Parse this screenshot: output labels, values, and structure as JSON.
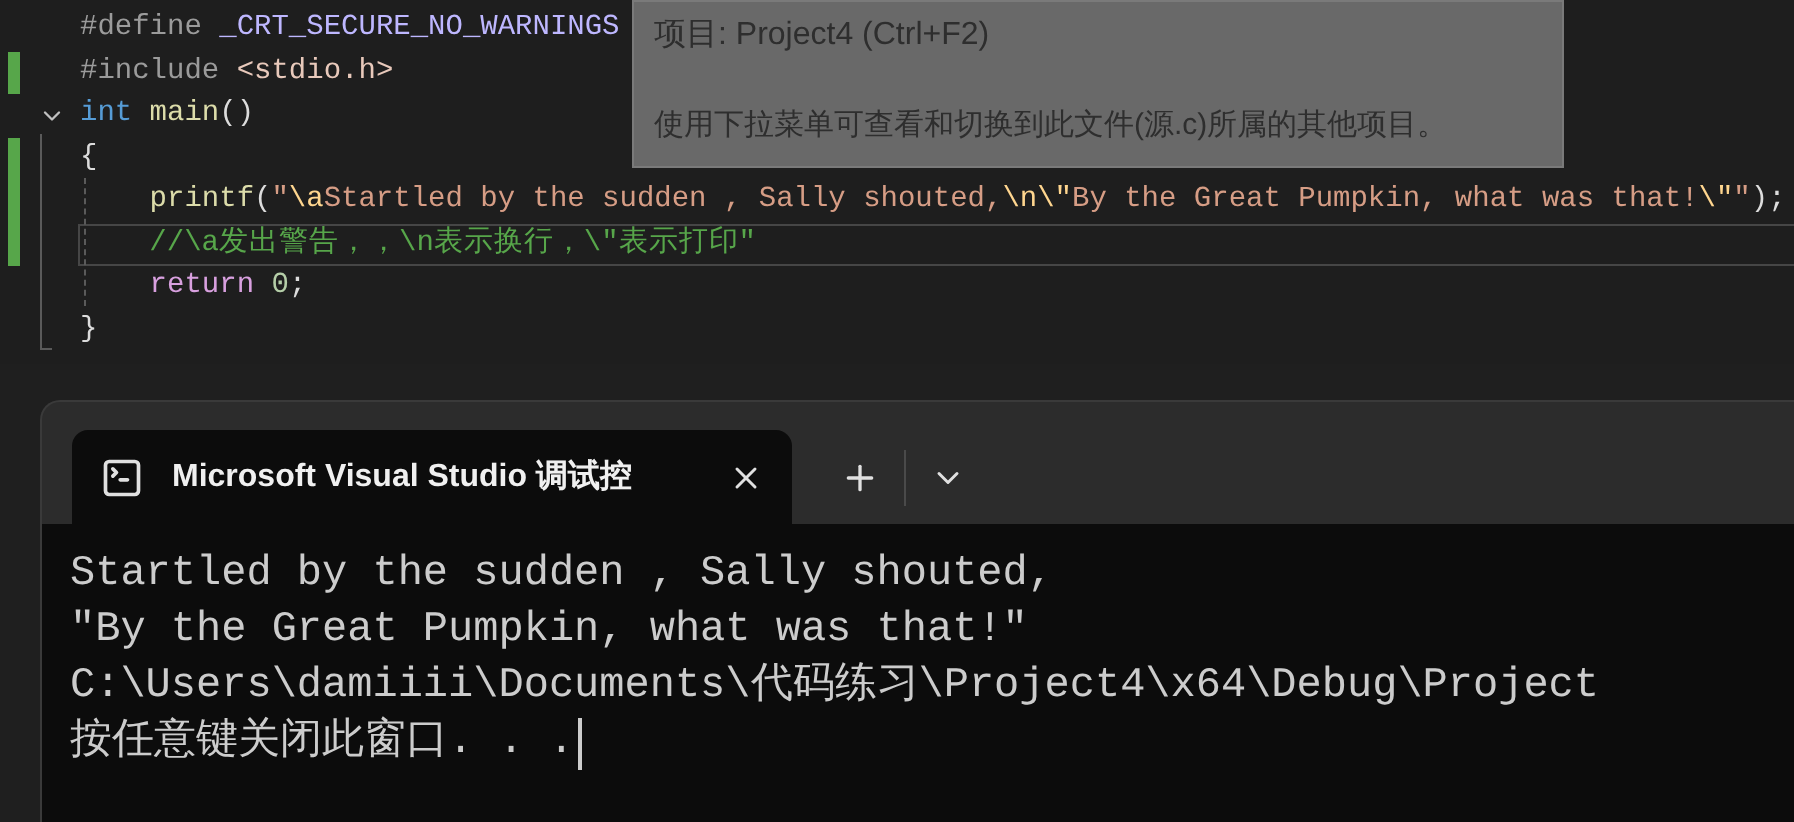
{
  "editor": {
    "lines": [
      {
        "modified": false,
        "current": false,
        "fold": false,
        "tokens": [
          {
            "text": "#define ",
            "kind": "preprocessor"
          },
          {
            "text": "_CRT_SECURE_NO_WARNINGS",
            "kind": "macro"
          }
        ]
      },
      {
        "modified": true,
        "current": false,
        "fold": false,
        "tokens": [
          {
            "text": "#include ",
            "kind": "preprocessor"
          },
          {
            "text": "<stdio.h>",
            "kind": "header"
          }
        ]
      },
      {
        "modified": false,
        "current": false,
        "fold": true,
        "tokens": [
          {
            "text": "int",
            "kind": "keyword"
          },
          {
            "text": " main",
            "kind": "function"
          },
          {
            "text": "()",
            "kind": "plain"
          }
        ]
      },
      {
        "modified": true,
        "current": false,
        "fold": false,
        "tokens": [
          {
            "text": "{",
            "kind": "plain"
          }
        ]
      },
      {
        "modified": true,
        "current": false,
        "fold": false,
        "tokens": [
          {
            "text": "    printf",
            "kind": "function"
          },
          {
            "text": "(",
            "kind": "plain"
          },
          {
            "text": "\"",
            "kind": "string"
          },
          {
            "text": "\\a",
            "kind": "escape"
          },
          {
            "text": "Startled by the sudden , Sally shouted,",
            "kind": "string"
          },
          {
            "text": "\\n\\\"",
            "kind": "escape"
          },
          {
            "text": "By the Great Pumpkin, what was that!",
            "kind": "string"
          },
          {
            "text": "\\\"",
            "kind": "escape"
          },
          {
            "text": "\"",
            "kind": "string"
          },
          {
            "text": ");",
            "kind": "plain"
          }
        ]
      },
      {
        "modified": true,
        "current": true,
        "fold": false,
        "tokens": [
          {
            "text": "    //\\a发出警告，，\\n表示换行，\\\"表示打印\"",
            "kind": "comment"
          }
        ]
      },
      {
        "modified": false,
        "current": false,
        "fold": false,
        "tokens": [
          {
            "text": "    return",
            "kind": "control"
          },
          {
            "text": " 0",
            "kind": "number"
          },
          {
            "text": ";",
            "kind": "plain"
          }
        ]
      },
      {
        "modified": false,
        "current": false,
        "fold": false,
        "tokens": [
          {
            "text": "}",
            "kind": "plain"
          }
        ]
      }
    ]
  },
  "tooltip": {
    "title": "项目: Project4 (Ctrl+F2)",
    "description": "使用下拉菜单可查看和切换到此文件(源.c)所属的其他项目。"
  },
  "terminal": {
    "tab": {
      "title": "Microsoft Visual Studio 调试控",
      "selected": true
    },
    "lines": [
      "Startled by the sudden , Sally shouted,",
      "\"By the Great Pumpkin, what was that!\"",
      "C:\\Users\\damiiii\\Documents\\代码练习\\Project4\\x64\\Debug\\Project",
      "按任意键关闭此窗口. . ."
    ]
  }
}
